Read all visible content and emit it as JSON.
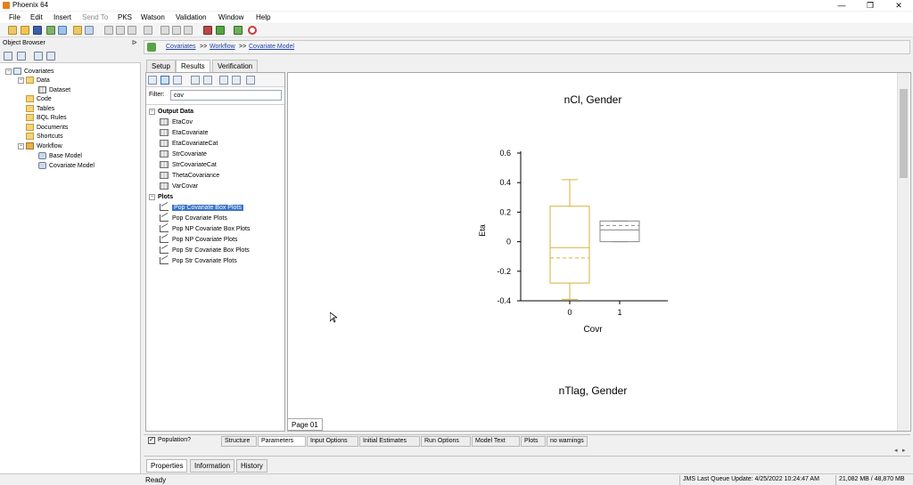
{
  "window": {
    "title": "Phoenix 64",
    "minimize_glyph": "—",
    "restore_glyph": "❐",
    "close_glyph": "✕"
  },
  "menu": [
    "File",
    "Edit",
    "Insert",
    "Send To",
    "PKS",
    "Watson",
    "Validation",
    "Window",
    "Help"
  ],
  "object_browser": {
    "title": "Object Browser",
    "pin_glyph": "ᐅ",
    "tree": [
      {
        "label": "Covariates"
      },
      {
        "label": "Data"
      },
      {
        "label": "Dataset"
      },
      {
        "label": "Code"
      },
      {
        "label": "Tables"
      },
      {
        "label": "BQL Rules"
      },
      {
        "label": "Documents"
      },
      {
        "label": "Shortcuts"
      },
      {
        "label": "Workflow"
      },
      {
        "label": "Base Model"
      },
      {
        "label": "Covariate Model"
      }
    ]
  },
  "breadcrumb": {
    "items": [
      "Covariates",
      "Workflow",
      "Covariate Model"
    ],
    "separator": ">>"
  },
  "tabs": [
    "Setup",
    "Results",
    "Verification"
  ],
  "active_tab": "Results",
  "results": {
    "filter_label": "Filter:",
    "filter_value": "cov",
    "groups": [
      {
        "label": "Output Data",
        "toggle": "−",
        "items": [
          "EtaCov",
          "EtaCovariate",
          "EtaCovariateCat",
          "StrCovariate",
          "StrCovariateCat",
          "ThetaCovariance",
          "VarCovar"
        ]
      },
      {
        "label": "Plots",
        "toggle": "−",
        "items": [
          "Pop Covariate Box Plots",
          "Pop Covariate Plots",
          "Pop NP Covariate Box Plots",
          "Pop NP Covariate Plots",
          "Pop Str Covariate Box Plots",
          "Pop Str Covariate Plots"
        ]
      }
    ],
    "selected_item": "Pop Covariate Box Plots"
  },
  "chart_data": {
    "type": "box",
    "title": "nCl, Gender",
    "xlabel": "Covr",
    "ylabel": "Eta",
    "categories": [
      "0",
      "1"
    ],
    "ylim": [
      -0.4,
      0.6
    ],
    "yticks": [
      "0.6",
      "0.4",
      "0.2",
      "0",
      "-0.2",
      "-0.4"
    ],
    "ytick_values": [
      0.6,
      0.4,
      0.2,
      0,
      -0.2,
      -0.4
    ],
    "boxes": [
      {
        "category": "0",
        "whisker_low": -0.39,
        "q1": -0.28,
        "median": -0.04,
        "mean": -0.11,
        "q3": 0.24,
        "whisker_high": 0.42,
        "color": "#d6b23a"
      },
      {
        "category": "1",
        "whisker_low": 0.0,
        "q1": 0.0,
        "median": 0.08,
        "mean": 0.11,
        "q3": 0.14,
        "whisker_high": 0.14,
        "color": "#888888"
      }
    ],
    "next_title": "nTlag, Gender"
  },
  "page_tab": "Page 01",
  "bottom_tabs": {
    "population_label": "Population?",
    "population_checked": "✓",
    "items": [
      "Structure",
      "Parameters",
      "Input Options",
      "Initial Estimates",
      "Run Options",
      "Model Text",
      "Plots",
      "no warnings"
    ]
  },
  "scroll": {
    "left_glyph": "◂",
    "right_glyph": "▸"
  },
  "property_tabs": [
    "Properties",
    "Information",
    "History"
  ],
  "status": {
    "ready": "Ready",
    "jms": "JMS Last Queue Update: 4/25/2022 10:24:47 AM",
    "memory": "21,082 MB / 48,870 MB"
  },
  "colors": {
    "accent": "#3a73c7",
    "box0": "#d6b23a",
    "box1": "#888888",
    "link": "#1a3fa8"
  }
}
